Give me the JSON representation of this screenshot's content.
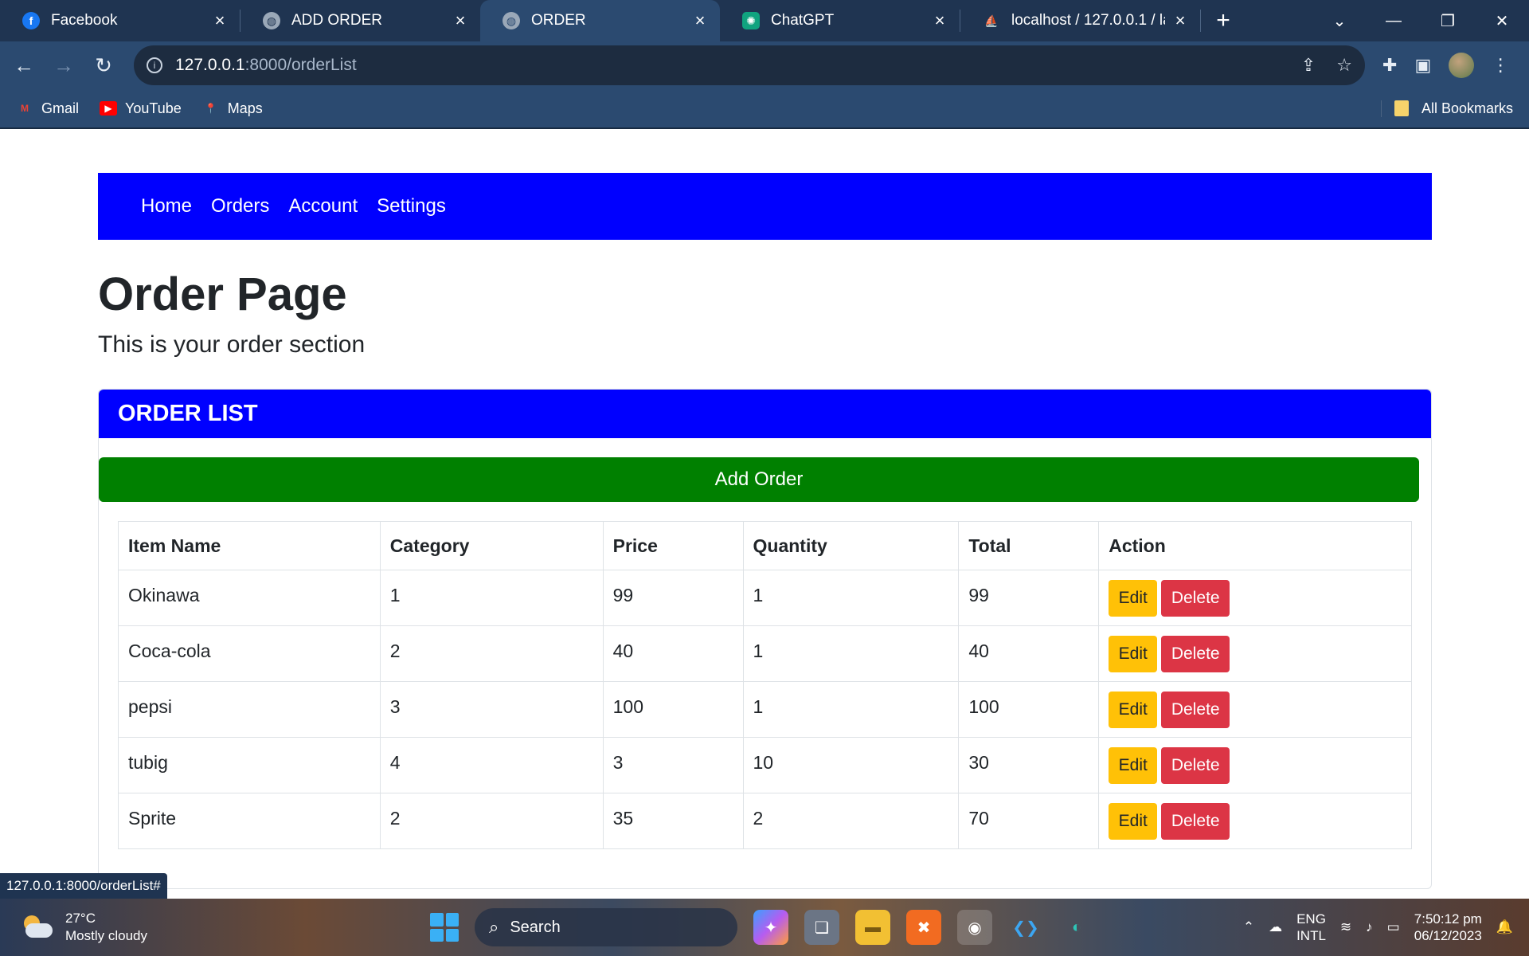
{
  "browser": {
    "tabs": [
      {
        "title": "Facebook",
        "icon": "facebook-icon",
        "active": false
      },
      {
        "title": "ADD ORDER",
        "icon": "globe-icon",
        "active": false
      },
      {
        "title": "ORDER",
        "icon": "globe-icon",
        "active": true
      },
      {
        "title": "ChatGPT",
        "icon": "chatgpt-icon",
        "active": false
      },
      {
        "title": "localhost / 127.0.0.1 / lar",
        "icon": "phpmyadmin-icon",
        "active": false
      }
    ],
    "url_host": "127.0.0.1",
    "url_path": ":8000/orderList",
    "bookmarks": [
      {
        "label": "Gmail",
        "icon": "gmail-icon"
      },
      {
        "label": "YouTube",
        "icon": "youtube-icon"
      },
      {
        "label": "Maps",
        "icon": "maps-icon"
      }
    ],
    "all_bookmarks": "All Bookmarks",
    "status_url": "127.0.0.1:8000/orderList#"
  },
  "nav": {
    "links": [
      "Home",
      "Orders",
      "Account",
      "Settings"
    ]
  },
  "page": {
    "title": "Order Page",
    "subtitle": "This is your order section"
  },
  "card": {
    "header": "ORDER LIST",
    "add_button": "Add Order"
  },
  "table": {
    "headers": [
      "Item Name",
      "Category",
      "Price",
      "Quantity",
      "Total",
      "Action"
    ],
    "rows": [
      [
        "Okinawa",
        "1",
        "99",
        "1",
        "99"
      ],
      [
        "Coca-cola",
        "2",
        "40",
        "1",
        "40"
      ],
      [
        "pepsi",
        "3",
        "100",
        "1",
        "100"
      ],
      [
        "tubig",
        "4",
        "3",
        "10",
        "30"
      ],
      [
        "Sprite",
        "2",
        "35",
        "2",
        "70"
      ]
    ],
    "edit_label": "Edit",
    "delete_label": "Delete"
  },
  "taskbar": {
    "temperature": "27°C",
    "weather": "Mostly cloudy",
    "search_placeholder": "Search",
    "lang_line1": "ENG",
    "lang_line2": "INTL",
    "time": "7:50:12 pm",
    "date": "06/12/2023"
  },
  "colors": {
    "nav_bg": "#0000ff",
    "add_button": "#008000",
    "edit_button": "#ffc107",
    "delete_button": "#dc3545"
  }
}
